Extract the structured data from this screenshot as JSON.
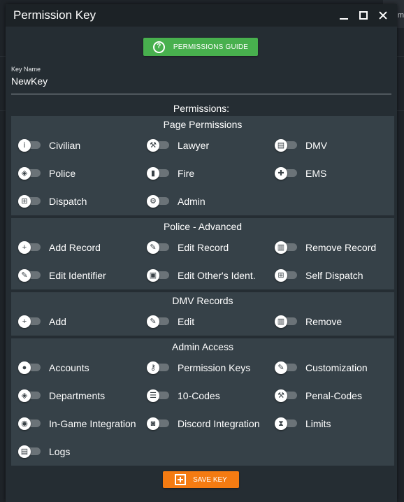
{
  "app": {
    "title": "Permission Key",
    "background_text": "m"
  },
  "guide_button": {
    "label": "PERMISSIONS GUIDE",
    "icon": "help-circle-icon"
  },
  "key_name": {
    "label": "Key Name",
    "value": "NewKey"
  },
  "permissions_heading": "Permissions:",
  "sections": [
    {
      "title": "Page Permissions",
      "items": [
        {
          "label": "Civilian",
          "icon": "info-icon",
          "glyph": "i",
          "enabled": false
        },
        {
          "label": "Lawyer",
          "icon": "gavel-icon",
          "glyph": "⚒",
          "enabled": false
        },
        {
          "label": "DMV",
          "icon": "id-card-icon",
          "glyph": "▤",
          "enabled": false
        },
        {
          "label": "Police",
          "icon": "shield-icon",
          "glyph": "◈",
          "enabled": false
        },
        {
          "label": "Fire",
          "icon": "fire-extinguisher-icon",
          "glyph": "▮",
          "enabled": false
        },
        {
          "label": "EMS",
          "icon": "medkit-icon",
          "glyph": "✚",
          "enabled": false
        },
        {
          "label": "Dispatch",
          "icon": "sitemap-icon",
          "glyph": "⊞",
          "enabled": false
        },
        {
          "label": "Admin",
          "icon": "users-cog-icon",
          "glyph": "⚙",
          "enabled": false
        }
      ]
    },
    {
      "title": "Police - Advanced",
      "items": [
        {
          "label": "Add Record",
          "icon": "plus-icon",
          "glyph": "+",
          "enabled": false
        },
        {
          "label": "Edit Record",
          "icon": "pencil-icon",
          "glyph": "✎",
          "enabled": false
        },
        {
          "label": "Remove Record",
          "icon": "trash-icon",
          "glyph": "▥",
          "enabled": false
        },
        {
          "label": "Edit Identifier",
          "icon": "pencil-icon",
          "glyph": "✎",
          "enabled": false
        },
        {
          "label": "Edit Other's Ident.",
          "icon": "id-badge-icon",
          "glyph": "▣",
          "enabled": false
        },
        {
          "label": "Self Dispatch",
          "icon": "sitemap-icon",
          "glyph": "⊞",
          "enabled": false
        }
      ]
    },
    {
      "title": "DMV Records",
      "items": [
        {
          "label": "Add",
          "icon": "plus-icon",
          "glyph": "+",
          "enabled": false
        },
        {
          "label": "Edit",
          "icon": "pencil-icon",
          "glyph": "✎",
          "enabled": false
        },
        {
          "label": "Remove",
          "icon": "trash-icon",
          "glyph": "▥",
          "enabled": false
        }
      ]
    },
    {
      "title": "Admin Access",
      "items": [
        {
          "label": "Accounts",
          "icon": "user-icon",
          "glyph": "●",
          "enabled": false
        },
        {
          "label": "Permission Keys",
          "icon": "key-icon",
          "glyph": "⚷",
          "enabled": false
        },
        {
          "label": "Customization",
          "icon": "paint-brush-icon",
          "glyph": "✎",
          "enabled": false
        },
        {
          "label": "Departments",
          "icon": "shield-icon",
          "glyph": "◈",
          "enabled": false
        },
        {
          "label": "10-Codes",
          "icon": "list-icon",
          "glyph": "☰",
          "enabled": false
        },
        {
          "label": "Penal-Codes",
          "icon": "gavel-icon",
          "glyph": "⚒",
          "enabled": false
        },
        {
          "label": "In-Game Integration",
          "icon": "gamepad-icon",
          "glyph": "◉",
          "enabled": false
        },
        {
          "label": "Discord Integration",
          "icon": "discord-icon",
          "glyph": "◙",
          "enabled": false
        },
        {
          "label": "Limits",
          "icon": "hourglass-icon",
          "glyph": "⧗",
          "enabled": false
        },
        {
          "label": "Logs",
          "icon": "clipboard-icon",
          "glyph": "▤",
          "enabled": false
        }
      ]
    }
  ],
  "save_button": {
    "label": "SAVE KEY",
    "icon": "plus-square-icon"
  }
}
